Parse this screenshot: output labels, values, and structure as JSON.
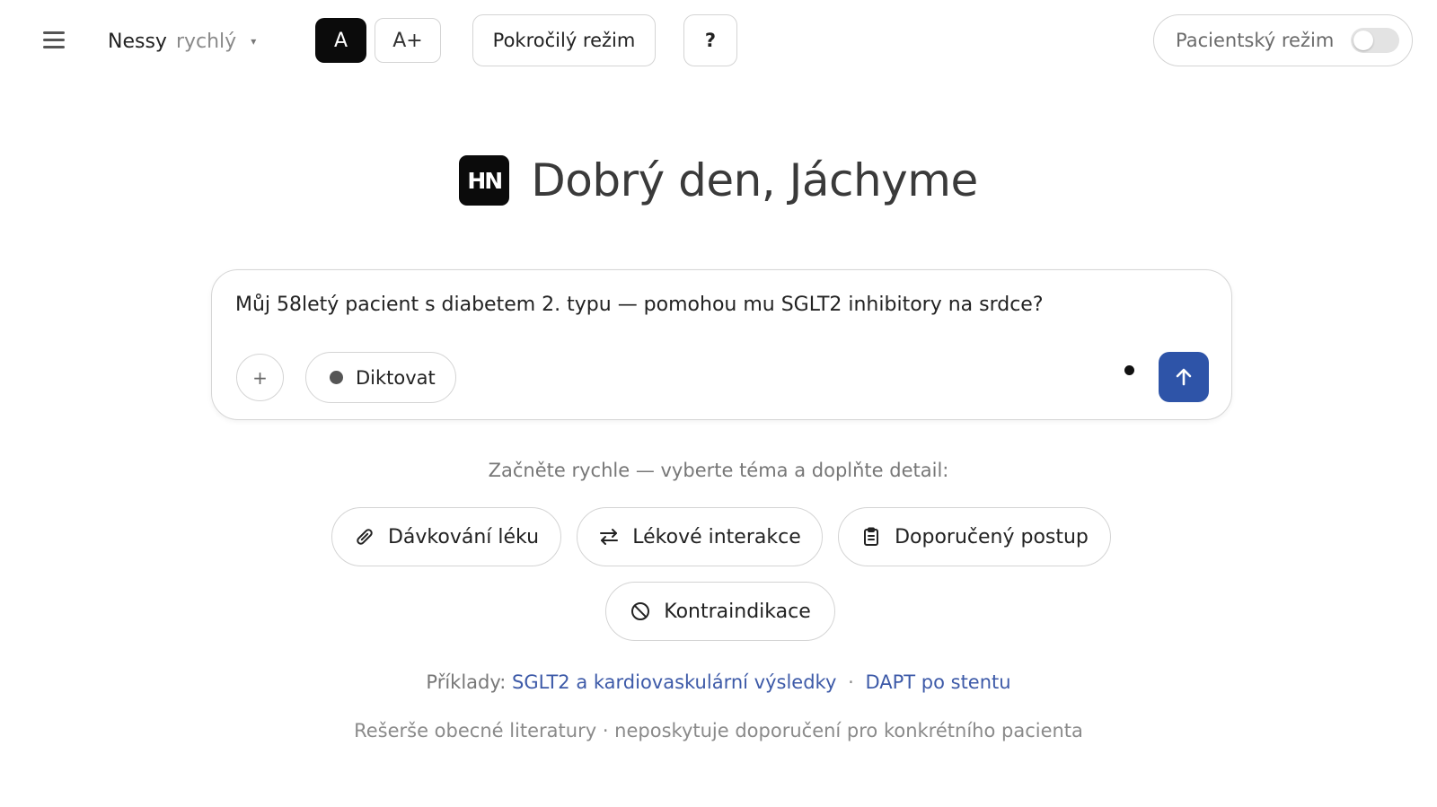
{
  "header": {
    "menu_icon": "hamburger-menu-icon",
    "model": {
      "name": "Nessy",
      "variant": "rychlý",
      "caret": "▾"
    },
    "font_size": {
      "normal_label": "A",
      "large_label": "A+",
      "active": "normal"
    },
    "advanced_mode_label": "Pokročilý režim",
    "help_label": "?",
    "patient_mode": {
      "label": "Pacientský režim",
      "enabled": false
    }
  },
  "greeting": {
    "logo_text": "HN",
    "text": "Dobrý den, Jáchyme"
  },
  "composer": {
    "input_value": "Můj 58letý pacient s diabetem 2. typu — pomohou mu SGLT2 inhibitory na srdce?",
    "attach_label": "+",
    "dictate_label": "Diktovat",
    "send_icon": "arrow-up-icon"
  },
  "quick_start": {
    "hint": "Začněte rychle — vyberte téma a doplňte detail:",
    "chips": [
      {
        "label": "Dávkování léku",
        "icon": "pill-icon"
      },
      {
        "label": "Lékové interakce",
        "icon": "swap-arrows-icon"
      },
      {
        "label": "Doporučený postup",
        "icon": "clipboard-icon"
      },
      {
        "label": "Kontraindikace",
        "icon": "prohibited-icon"
      }
    ]
  },
  "examples": {
    "label": "Příklady:",
    "items": [
      "SGLT2 a kardiovaskulární výsledky",
      "DAPT po stentu"
    ],
    "separator": "·"
  },
  "disclaimer": "Rešerše obecné literatury · neposkytuje doporučení pro konkrétního pacienta",
  "colors": {
    "accent": "#2e54a8",
    "link": "#3d5aa8",
    "dark": "#0b0b0b",
    "border": "#d4d4d4"
  }
}
